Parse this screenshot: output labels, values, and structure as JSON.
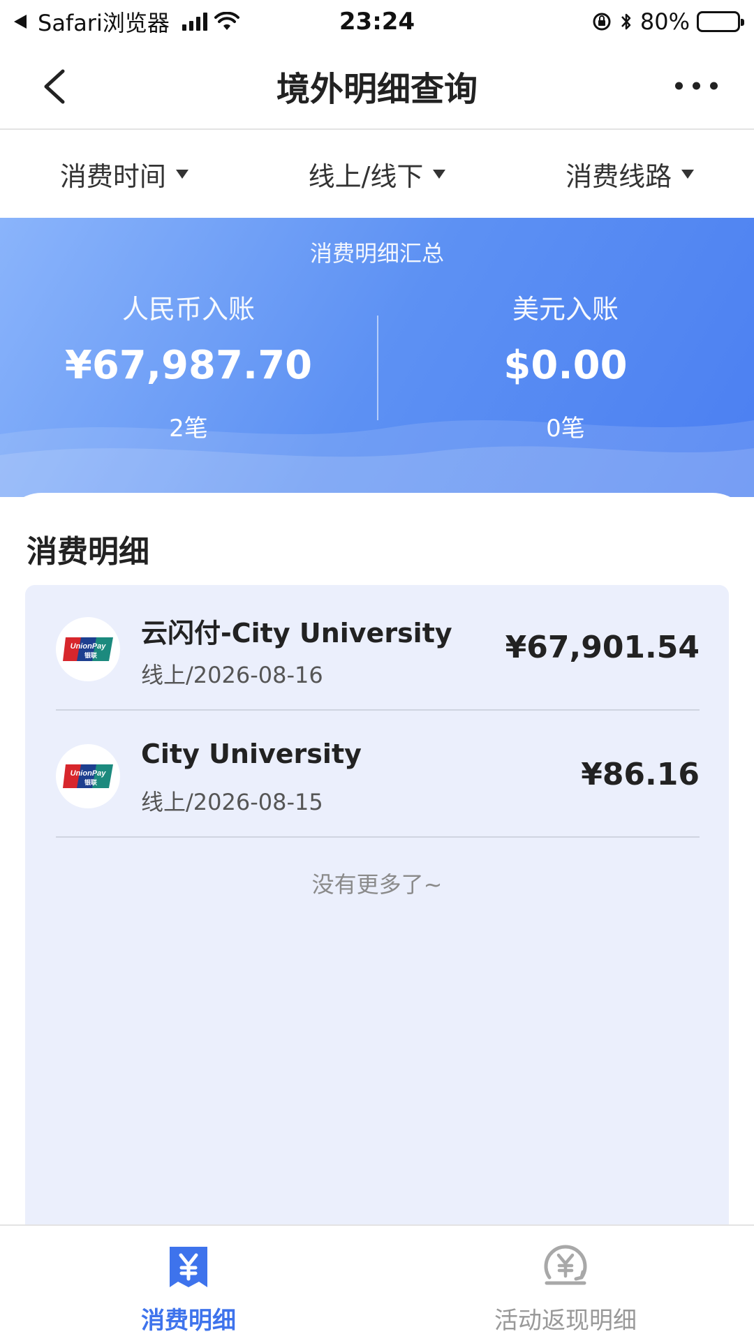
{
  "status_bar": {
    "back_app": "Safari浏览器",
    "time": "23:24",
    "battery": "80%"
  },
  "nav": {
    "title": "境外明细查询"
  },
  "filters": [
    {
      "label": "消费时间"
    },
    {
      "label": "线上/线下"
    },
    {
      "label": "消费线路"
    }
  ],
  "summary": {
    "title": "消费明细汇总",
    "cny": {
      "label": "人民币入账",
      "amount": "¥67,987.70",
      "count": "2笔"
    },
    "usd": {
      "label": "美元入账",
      "amount": "$0.00",
      "count": "0笔"
    }
  },
  "details": {
    "title": "消费明细",
    "transactions": [
      {
        "merchant": "云闪付-City University",
        "meta": "线上/2026-08-16",
        "amount": "¥67,901.54",
        "logo": "unionpay-logo"
      },
      {
        "merchant": "City University",
        "meta": "线上/2026-08-15",
        "amount": "¥86.16",
        "logo": "unionpay-logo"
      }
    ],
    "no_more": "没有更多了~"
  },
  "tabs": [
    {
      "label": "消费明细",
      "icon": "yuan-receipt-icon",
      "active": true
    },
    {
      "label": "活动返现明细",
      "icon": "yuan-cashback-icon",
      "active": false
    }
  ],
  "colors": {
    "accent": "#3e73ec",
    "banner_start": "#8ab4fb",
    "banner_end": "#4b7ff2",
    "list_bg": "#ebeffc"
  }
}
